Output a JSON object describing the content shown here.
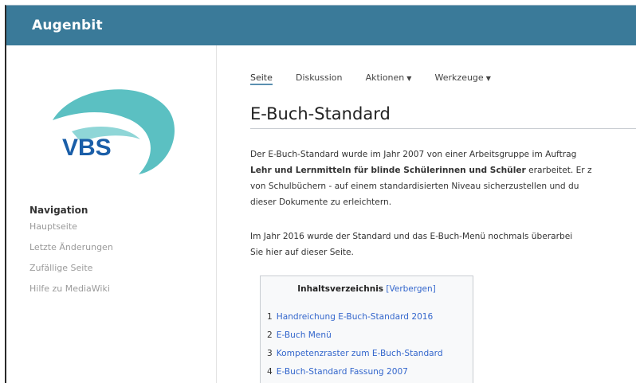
{
  "header": {
    "brand": "Augenbit"
  },
  "logo": {
    "text": "VBS",
    "swoosh_color": "#5bc0c2",
    "text_color": "#1a5ea8"
  },
  "sidebar": {
    "heading": "Navigation",
    "items": [
      {
        "label": "Hauptseite"
      },
      {
        "label": "Letzte Änderungen"
      },
      {
        "label": "Zufällige Seite"
      },
      {
        "label": "Hilfe zu MediaWiki"
      }
    ]
  },
  "tabs": [
    {
      "label": "Seite",
      "active": true
    },
    {
      "label": "Diskussion"
    },
    {
      "label": "Aktionen",
      "dropdown_icon": "caret-down-icon"
    },
    {
      "label": "Werkzeuge",
      "dropdown_icon": "caret-down-icon"
    }
  ],
  "page": {
    "title": "E-Buch-Standard",
    "para1": {
      "line1": "Der E-Buch-Standard wurde im Jahr 2007 von einer Arbeitsgruppe im Auftrag",
      "line2_bold": "Lehr und Lernmitteln für blinde Schülerinnen und Schüler",
      "line2_rest": " erarbeitet. Er z",
      "line3": "von Schulbüchern - auf einem standardisierten Niveau sicherzustellen und du",
      "line4": "dieser Dokumente zu erleichtern."
    },
    "para2": {
      "line1": "Im Jahr 2016 wurde der Standard und das E-Buch-Menü nochmals überarbei",
      "line2": "Sie hier auf dieser Seite."
    }
  },
  "toc": {
    "title": "Inhaltsverzeichnis",
    "toggle": "[Verbergen]",
    "items": [
      {
        "num": "1",
        "label": "Handreichung E-Buch-Standard 2016"
      },
      {
        "num": "2",
        "label": "E-Buch Menü"
      },
      {
        "num": "3",
        "label": "Kompetenzraster zum E-Buch-Standard"
      },
      {
        "num": "4",
        "label": "E-Buch-Standard Fassung 2007"
      }
    ]
  },
  "colors": {
    "header_bg": "#3a7a99",
    "link": "#3366cc",
    "active_tab_underline": "#5a8fb0"
  }
}
